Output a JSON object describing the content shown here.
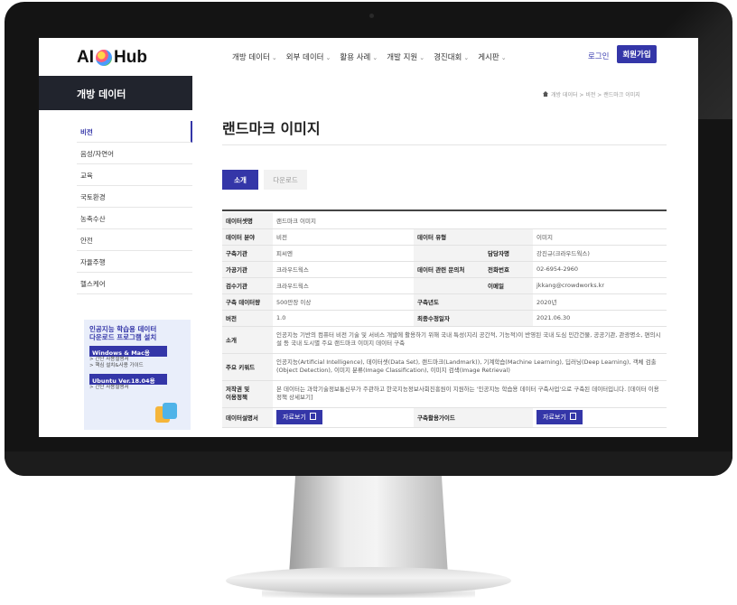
{
  "header": {
    "logo_text_left": "AI",
    "logo_text_right": "Hub",
    "nav": [
      "개방 데이터",
      "외부 데이터",
      "활용 사례",
      "개발 지원",
      "경진대회",
      "게시판"
    ],
    "login_label": "로그인",
    "signup_label": "회원가입"
  },
  "sidebar": {
    "title": "개방 데이터",
    "items": [
      "비전",
      "음성/자연어",
      "교육",
      "국토환경",
      "농축수산",
      "안전",
      "자율주행",
      "헬스케어"
    ],
    "active_index": 0
  },
  "promo": {
    "title_line1": "인공지능 학습용 데이터",
    "title_line2": "다운로드 프로그램 설치",
    "windows_label": "Windows & Mac용",
    "windows_links": [
      "> 간단 사용설명서",
      "> 핵심 설치&사용 가이드"
    ],
    "ubuntu_label": "Ubuntu Ver.18.04용",
    "ubuntu_links": [
      "> 간단 사용설명서"
    ]
  },
  "breadcrumb": "개방 데이터 > 비전 > 랜드마크 이미지",
  "page": {
    "title": "랜드마크 이미지",
    "tabs": [
      "소개",
      "다운로드"
    ]
  },
  "info": {
    "dataset_name_label": "데이터셋명",
    "dataset_name": "랜드마크 이미지",
    "field_label": "데이터 분야",
    "field": "비전",
    "type_label": "데이터 유형",
    "type": "이미지",
    "builder_label": "구축기관",
    "builder": "피씨엔",
    "manager_label": "담당자명",
    "manager": "강진규(크라우드웍스)",
    "processor_label": "가공기관",
    "processor": "크라우드웍스",
    "inquiry_label": "데이터 관련 문의처",
    "phone_label": "전화번호",
    "phone": "02-6954-2960",
    "inspector_label": "검수기관",
    "inspector": "크라우드웍스",
    "email_label": "이메일",
    "email": "jkkang@crowdworks.kr",
    "volume_label": "구축 데이터량",
    "volume": "500만장 이상",
    "year_label": "구축년도",
    "year": "2020년",
    "version_label": "버전",
    "version": "1.0",
    "modified_label": "최종수정일자",
    "modified": "2021.06.30",
    "intro_label": "소개",
    "intro": "인공지능 기반의 컴퓨터 비전 기술 및 서비스 개발에 활용하기 위해 국내 특성(지리 공간적, 기능적)이 반영된 국내 도심 민간건물, 공공기관, 관광명소, 편의시설 등 국내 도시별 주요 랜드마크 이미지 데이터 구축",
    "keywords_label": "주요 키워드",
    "keywords": "인공지능(Artificial Intelligence), 데이터셋(Data Set), 랜드마크(Landmark)), 기계학습(Machine Learning), 딥러닝(Deep Learning), 객체 검출(Object Detection), 이미지 분류(Image Classification), 이미지 검색(Image Retrieval)",
    "copyright_label_1": "저작권 및",
    "copyright_label_2": "이용정책",
    "copyright": "본 데이터는 과학기술정보통신부가 주관하고 한국지능정보사회진흥원이 지원하는 '인공지능 학습용 데이터 구축사업'으로 구축된 데이터입니다. [데이터 이용정책 상세보기]",
    "spec_label": "데이터설명서",
    "guide_label": "구축활용가이드",
    "view_label": "자료보기"
  }
}
